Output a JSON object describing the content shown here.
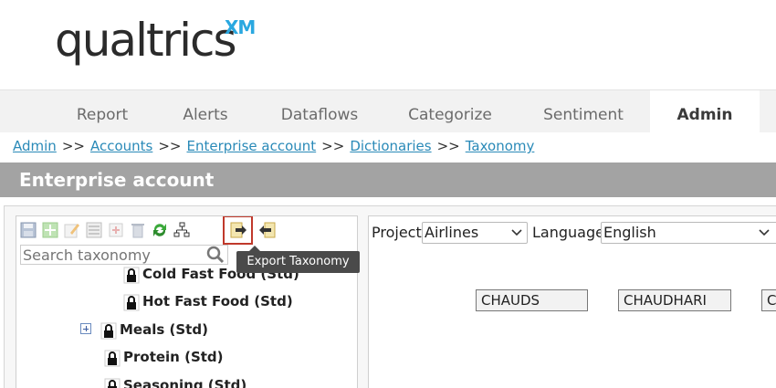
{
  "logo": {
    "main": "qualtrics",
    "superscript": "XM"
  },
  "nav": {
    "tabs": [
      {
        "label": "Report"
      },
      {
        "label": "Alerts"
      },
      {
        "label": "Dataflows"
      },
      {
        "label": "Categorize"
      },
      {
        "label": "Sentiment"
      },
      {
        "label": "Admin",
        "active": true
      }
    ]
  },
  "breadcrumb": {
    "items": [
      "Admin",
      "Accounts",
      "Enterprise account",
      "Dictionaries",
      "Taxonomy"
    ],
    "separator": ">>"
  },
  "title": "Enterprise account",
  "toolbar": {
    "buttons": [
      "save-icon",
      "add-icon",
      "edit-icon",
      "properties-icon",
      "add-child-icon",
      "delete-icon",
      "refresh-icon",
      "hierarchy-icon",
      "export-icon",
      "import-icon"
    ],
    "highlighted": "export-icon"
  },
  "tooltip": "Export Taxonomy",
  "search": {
    "placeholder": "Search taxonomy"
  },
  "tree": {
    "items": [
      {
        "label": "Cold Fast Food (Std)"
      },
      {
        "label": "Hot Fast Food (Std)"
      },
      {
        "label": "Meals (Std)",
        "expandable": true
      },
      {
        "label": "Protein (Std)"
      },
      {
        "label": "Seasoning (Std)"
      }
    ]
  },
  "filters": {
    "project_label": "Project:",
    "project_value": "Airlines",
    "language_label": "Language:",
    "language_value": "English"
  },
  "codes": [
    "CHAUDS",
    "CHAUDHARI",
    "C"
  ],
  "colors": {
    "accent": "#2a8ab8",
    "title_bar": "#a3a3a3",
    "highlight": "#c0392b"
  }
}
